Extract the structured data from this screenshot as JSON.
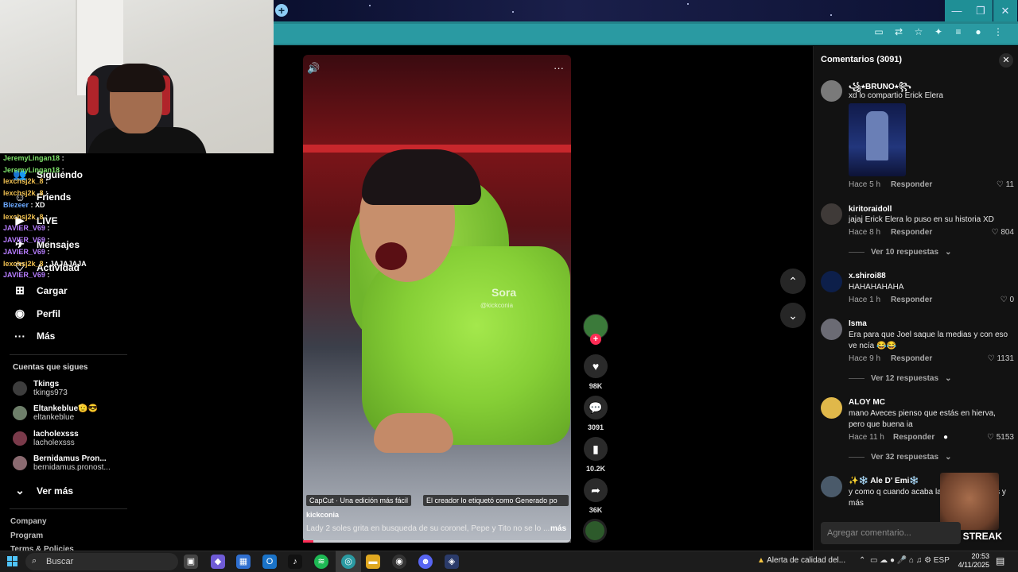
{
  "browser": {
    "new_tab_label": "+",
    "window_min": "—",
    "window_max": "❐",
    "window_close": "✕"
  },
  "chat_overlay": [
    {
      "user": "JeremyLingan18",
      "color": "#7ee36a",
      "msg": ":"
    },
    {
      "user": "JeremyLingan18",
      "color": "#7ee36a",
      "msg": ":"
    },
    {
      "user": "lexchsj2k_8",
      "color": "#f0c050",
      "msg": ":"
    },
    {
      "user": "lexchsj2k_8",
      "color": "#f0c050",
      "msg": ":"
    },
    {
      "user": "Blezeer",
      "color": "#6aa8ff",
      "msg": ": XD"
    },
    {
      "user": "lexchsj2k_8",
      "color": "#f0c050",
      "msg": ":"
    },
    {
      "user": "JAVIER_V69",
      "color": "#b77dff",
      "msg": ":"
    },
    {
      "user": "JAVIER_V69",
      "color": "#b77dff",
      "msg": ":"
    },
    {
      "user": "JAVIER_V69",
      "color": "#b77dff",
      "msg": ":"
    },
    {
      "user": "lexchsj2k_8",
      "color": "#f0c050",
      "msg": ": JAJAJAJA"
    },
    {
      "user": "JAVIER_V69",
      "color": "#b77dff",
      "msg": ":"
    }
  ],
  "sidebar": {
    "nav": [
      {
        "label": "Siguiendo",
        "icon": "users-icon"
      },
      {
        "label": "Friends",
        "icon": "friends-icon"
      },
      {
        "label": "LIVE",
        "icon": "live-icon"
      },
      {
        "label": "Mensajes",
        "icon": "messages-icon"
      },
      {
        "label": "Actividad",
        "icon": "activity-icon"
      },
      {
        "label": "Cargar",
        "icon": "upload-icon"
      },
      {
        "label": "Perfil",
        "icon": "profile-icon"
      },
      {
        "label": "Más",
        "icon": "more-icon"
      }
    ],
    "following_title": "Cuentas que sigues",
    "following": [
      {
        "name": "Tkings",
        "handle": "tkings973"
      },
      {
        "name": "Eltankeblue🫡😎",
        "handle": "eltankeblue"
      },
      {
        "name": "lacholexsss",
        "handle": "lacholexsss"
      },
      {
        "name": "Bernidamus Pron...",
        "handle": "bernidamus.pronost..."
      }
    ],
    "see_more": "Ver más",
    "footer": [
      "Company",
      "Program",
      "Terms & Policies"
    ]
  },
  "video": {
    "watermark": "Sora",
    "watermark_handle": "@kickconia",
    "capcut_chip": "CapCut · Una edición más fácil",
    "ai_chip": "El creador lo etiquetó como Generado po",
    "author": "kickconia",
    "description": "Lady 2 soles grita en busqueda de su coronel, Pepe y Tito no se lo ...",
    "more": "más",
    "progress_fraction": 0.04
  },
  "actions": {
    "likes": "98K",
    "comments": "3091",
    "saves": "10.2K",
    "shares": "36K"
  },
  "comments": {
    "title": "Comentarios (3091)",
    "input_placeholder": "Agregar comentario...",
    "reply_label": "Responder",
    "items": [
      {
        "name": "꧁⭑BRUNO⭑꧂",
        "text": "xd lo compartio Erick Elera",
        "time": "Hace 5 h",
        "likes": "11",
        "has_image": true
      },
      {
        "name": "kiritoraidoll",
        "text": "jajaj Erick Elera lo puso en su historia XD",
        "time": "Hace 8 h",
        "likes": "804",
        "replies": "Ver 10 respuestas"
      },
      {
        "name": "x.shiroi88",
        "text": "HAHAHAHAHA",
        "time": "Hace 1 h",
        "likes": "0"
      },
      {
        "name": "Isma",
        "text": "Era para que Joel saque la medias y con eso ve ncía 😂😂",
        "time": "Hace 9 h",
        "likes": "1131",
        "replies": "Ver 12 respuestas"
      },
      {
        "name": "ALOY MC",
        "text": "mano Aveces pienso que estás en hierva, pero que buena ia",
        "time": "Hace 11 h",
        "likes": "5153",
        "replies": "Ver 32 respuestas"
      },
      {
        "name": "✨❄️ Ale D' Emi❄️",
        "text": "y como q cuando acaba la van a venir más y más"
      }
    ]
  },
  "overlay_streak": "41X STREAK",
  "taskbar": {
    "search_placeholder": "Buscar",
    "alert": "Alerta de calidad del...",
    "lang": "ESP",
    "time": "20:53",
    "date": "4/11/2025"
  },
  "colors": {
    "accent": "#fe2c55",
    "chrome_teal": "#2a9aa2"
  }
}
